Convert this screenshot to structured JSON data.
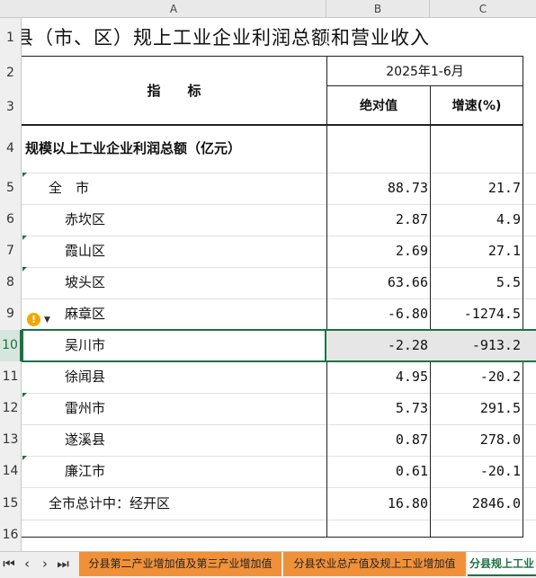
{
  "columns": {
    "a": "A",
    "b": "B",
    "c": "C"
  },
  "title": "各县（市、区）规上工业企业利润总额和营业收入",
  "header": {
    "indicator": "指　　标",
    "period": "2025年1-6月",
    "absolute": "绝对值",
    "growth": "增速(%)"
  },
  "section_label": "规模以上工业企业利润总额（亿元）",
  "row_numbers": [
    "1",
    "2",
    "3",
    "4",
    "5",
    "6",
    "7",
    "8",
    "9",
    "10",
    "11",
    "12",
    "13",
    "14",
    "15",
    "16"
  ],
  "rows": [
    {
      "name": "全　市",
      "value": "88.73",
      "growth": "21.7"
    },
    {
      "name": "赤坎区",
      "value": "2.87",
      "growth": "4.9"
    },
    {
      "name": "霞山区",
      "value": "2.69",
      "growth": "27.1"
    },
    {
      "name": "坡头区",
      "value": "63.66",
      "growth": "5.5"
    },
    {
      "name": "麻章区",
      "value": "-6.80",
      "growth": "-1274.5"
    },
    {
      "name": "吴川市",
      "value": "-2.28",
      "growth": "-913.2"
    },
    {
      "name": "徐闻县",
      "value": "4.95",
      "growth": "-20.2"
    },
    {
      "name": "雷州市",
      "value": "5.73",
      "growth": "291.5"
    },
    {
      "name": "遂溪县",
      "value": "0.87",
      "growth": "278.0"
    },
    {
      "name": "廉江市",
      "value": "0.61",
      "growth": "-20.1"
    },
    {
      "name": "全市总计中：经开区",
      "value": "16.80",
      "growth": "2846.0"
    }
  ],
  "tabs": [
    {
      "label": "分县第二产业增加值及第三产业增加值"
    },
    {
      "label": "分县农业总产值及规上工业增加值"
    },
    {
      "label": "分县规上工业"
    }
  ],
  "nav": {
    "first": "⏮",
    "prev": "‹",
    "next": "›",
    "last": "⏭"
  },
  "colors": {
    "accent": "#1e7145",
    "tab_orange": "#f0913a",
    "warning": "#f0a800"
  },
  "icons": {
    "warning": "warning-icon",
    "dropdown": "chevron-down-icon"
  }
}
